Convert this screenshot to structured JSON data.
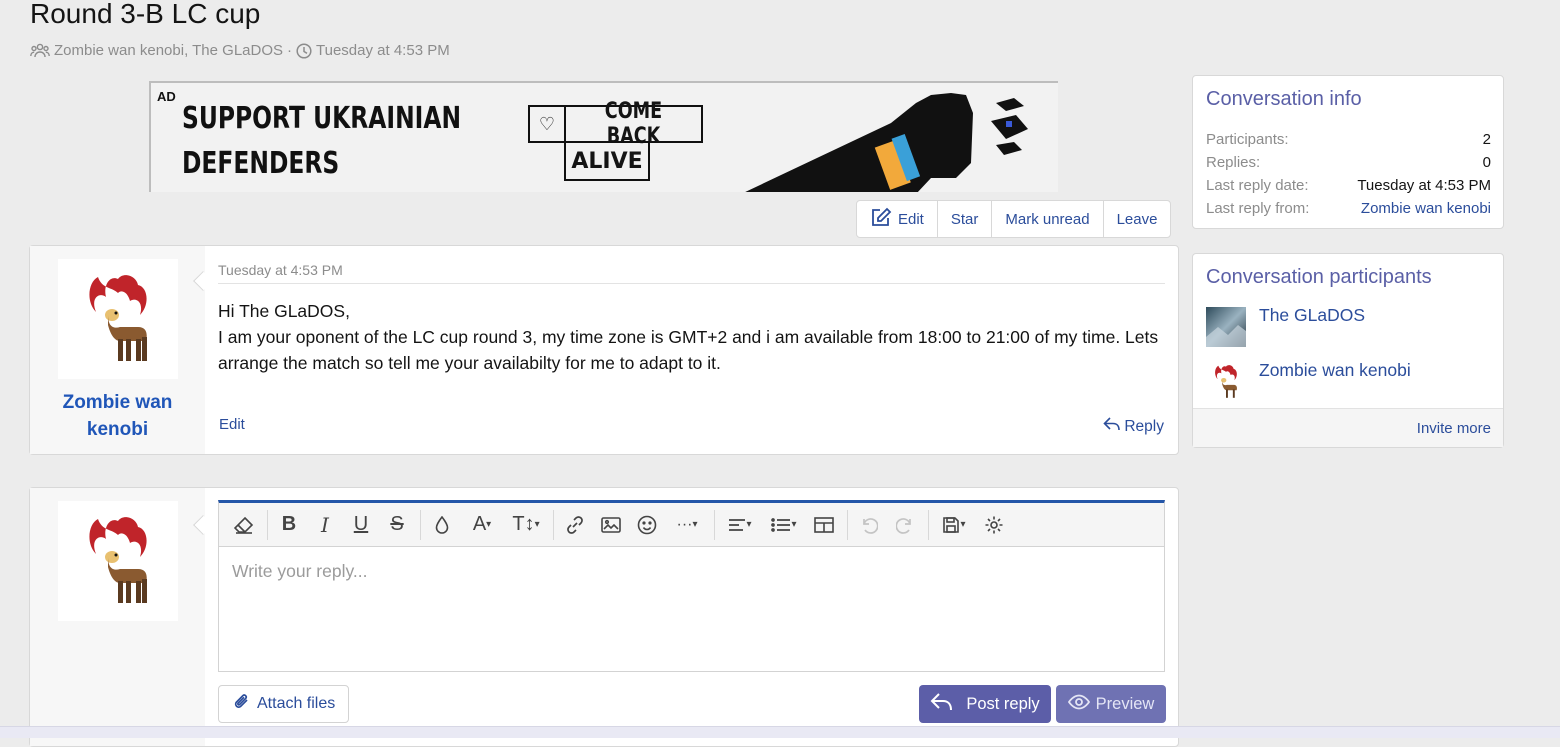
{
  "header": {
    "title": "Round 3-B LC cup",
    "participants": "Zombie wan kenobi, The GLaDOS",
    "separator": "·",
    "date": "Tuesday at 4:53 PM"
  },
  "ad": {
    "tag": "AD",
    "line1": "SUPPORT UKRAINIAN",
    "line2": "DEFENDERS",
    "cba_top": "COME BACK",
    "cba_bottom": "ALIVE"
  },
  "actions": {
    "edit": "Edit",
    "star": "Star",
    "mark_unread": "Mark unread",
    "leave": "Leave"
  },
  "message": {
    "author": "Zombie wan kenobi",
    "date": "Tuesday at 4:53 PM",
    "greeting": "Hi The GLaDOS,",
    "body": "I am your oponent of the LC cup round 3, my time zone is GMT+2 and i am available from 18:00 to 21:00 of my time. Lets arrange the match so tell me your availabilty for me to adapt to it.",
    "edit_label": "Edit",
    "reply_label": "Reply"
  },
  "reply_box": {
    "placeholder": "Write your reply...",
    "attach_label": "Attach files",
    "post_label": "Post reply",
    "preview_label": "Preview"
  },
  "conversation_info": {
    "title": "Conversation info",
    "rows": [
      {
        "label": "Participants:",
        "value": "2"
      },
      {
        "label": "Replies:",
        "value": "0"
      },
      {
        "label": "Last reply date:",
        "value": "Tuesday at 4:53 PM"
      },
      {
        "label": "Last reply from:",
        "value": "Zombie wan kenobi"
      }
    ]
  },
  "participants": {
    "title": "Conversation participants",
    "list": [
      {
        "name": "The GLaDOS"
      },
      {
        "name": "Zombie wan kenobi"
      }
    ],
    "invite_label": "Invite more"
  },
  "colors": {
    "accent": "#5c5ea8",
    "link": "#2b4d9b",
    "username": "#2056b8"
  }
}
